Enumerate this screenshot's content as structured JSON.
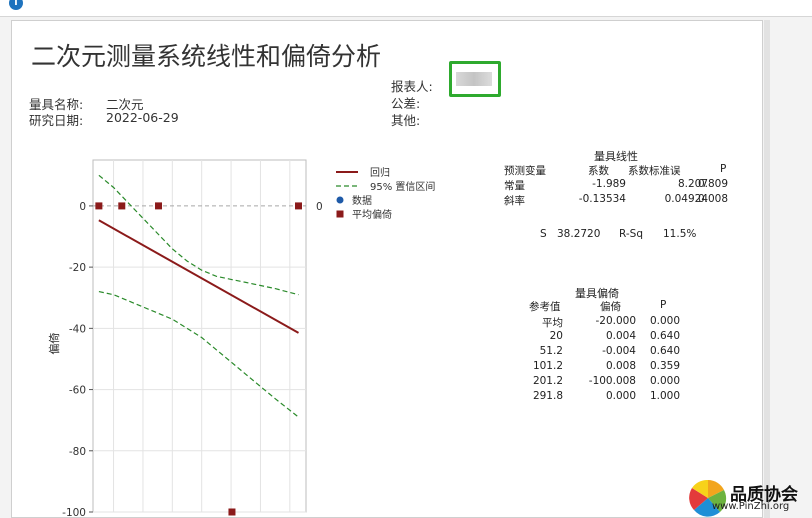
{
  "report": {
    "title": "二次元测量系统线性和偏倚分析",
    "gauge_name_label": "量具名称:",
    "gauge_name_value": "二次元",
    "study_date_label": "研究日期:",
    "study_date_value": "2022-06-29",
    "reported_by_label": "报表人:",
    "tolerance_label": "公差:",
    "other_label": "其他:"
  },
  "chart_data": {
    "type": "scatter",
    "ylabel": "偏倚",
    "ylim": [
      -100,
      15
    ],
    "y_ticks": [
      "0",
      "-20",
      "-40",
      "-60",
      "-80",
      "-100"
    ],
    "y_tick_values": [
      0,
      -20,
      -40,
      -60,
      -80,
      -100
    ],
    "reference_line_label": "0",
    "xlim": [
      12,
      302
    ],
    "x_gridlines": [
      40,
      80,
      120,
      160,
      200,
      240,
      280
    ],
    "mean_bias_points": [
      {
        "x": 20,
        "y": 0.004
      },
      {
        "x": 51.2,
        "y": -0.004
      },
      {
        "x": 101.2,
        "y": 0.008
      },
      {
        "x": 201.2,
        "y": -100.008
      },
      {
        "x": 291.8,
        "y": 0.0
      }
    ],
    "regression": {
      "intercept": -1.989,
      "slope": -0.13534,
      "x_start": 20,
      "x_end": 291.8
    },
    "ci_upper": [
      [
        20,
        10
      ],
      [
        40,
        6
      ],
      [
        60,
        1
      ],
      [
        80,
        -4
      ],
      [
        100,
        -9
      ],
      [
        120,
        -14
      ],
      [
        140,
        -18
      ],
      [
        160,
        -21
      ],
      [
        180,
        -23
      ],
      [
        200,
        -24
      ],
      [
        220,
        -25
      ],
      [
        240,
        -26
      ],
      [
        260,
        -27
      ],
      [
        291.8,
        -29
      ]
    ],
    "ci_lower": [
      [
        20,
        -28
      ],
      [
        40,
        -29
      ],
      [
        60,
        -31
      ],
      [
        80,
        -33
      ],
      [
        100,
        -35
      ],
      [
        120,
        -37
      ],
      [
        140,
        -40
      ],
      [
        160,
        -43
      ],
      [
        180,
        -47
      ],
      [
        200,
        -51
      ],
      [
        220,
        -55
      ],
      [
        240,
        -59
      ],
      [
        260,
        -63
      ],
      [
        291.8,
        -69
      ]
    ],
    "legend": [
      {
        "label": "回归",
        "kind": "solid-line",
        "color": "#8b1a1a"
      },
      {
        "label": "95% 置信区间",
        "kind": "dashed-line",
        "color": "#2a8a2a"
      },
      {
        "label": "数据",
        "kind": "dot",
        "color": "#1e5aa8"
      },
      {
        "label": "平均偏倚",
        "kind": "square",
        "color": "#8b1a1a"
      }
    ]
  },
  "linearity": {
    "title": "量具线性",
    "headers": [
      "预测变量",
      "系数",
      "系数标准误",
      "P"
    ],
    "rows": [
      [
        "常量",
        "-1.989",
        "8.207",
        "0.809"
      ],
      [
        "斜率",
        "-0.13534",
        "0.04924",
        "0.008"
      ]
    ],
    "s_label": "S",
    "s_value": "38.2720",
    "rsq_label": "R-Sq",
    "rsq_value": "11.5%"
  },
  "bias": {
    "title": "量具偏倚",
    "headers": [
      "参考值",
      "偏倚",
      "P"
    ],
    "rows": [
      [
        "平均",
        "-20.000",
        "0.000"
      ],
      [
        "20",
        "0.004",
        "0.640"
      ],
      [
        "51.2",
        "-0.004",
        "0.640"
      ],
      [
        "101.2",
        "0.008",
        "0.359"
      ],
      [
        "201.2",
        "-100.008",
        "0.000"
      ],
      [
        "291.8",
        "0.000",
        "1.000"
      ]
    ]
  },
  "watermark": {
    "name": "品质协会",
    "url": "www.PinZhi.org"
  },
  "colors": {
    "regression": "#8b1a1a",
    "ci": "#2a8a2a",
    "point": "#8b1a1a",
    "highlight_box": "#2eaa2e"
  }
}
